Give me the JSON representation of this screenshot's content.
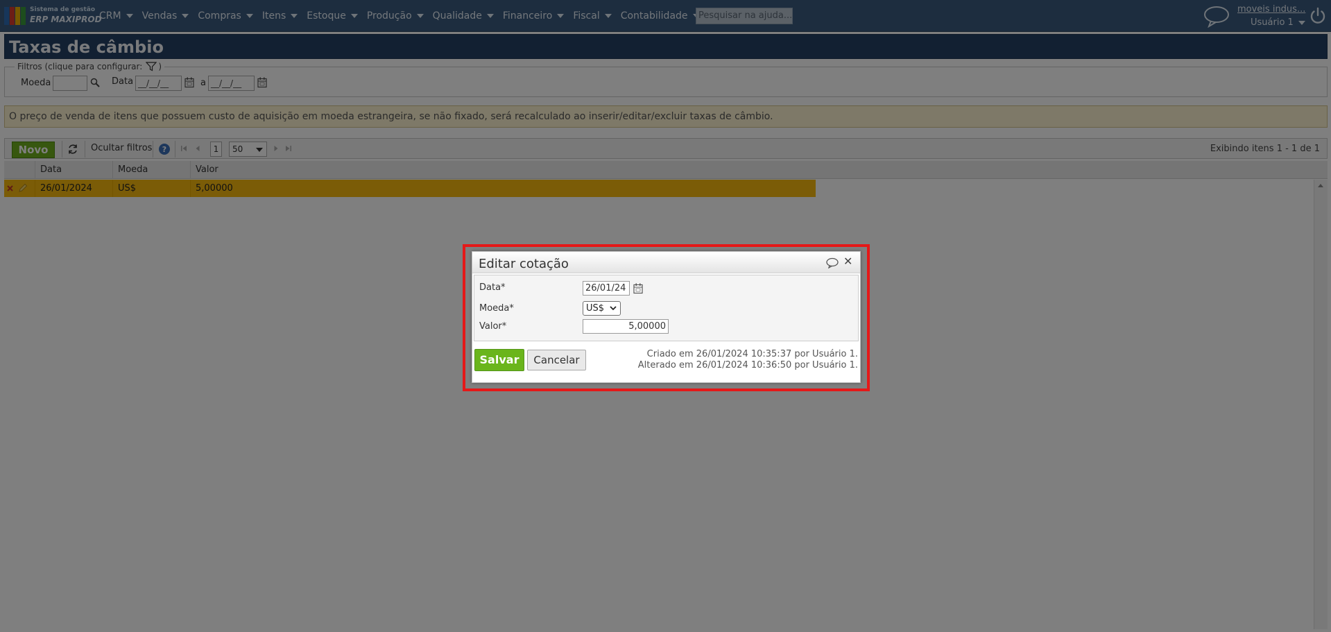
{
  "header": {
    "logo_line1": "Sistema de gestão",
    "logo_line2": "ERP MAXIPROD",
    "menu": [
      "CRM",
      "Vendas",
      "Compras",
      "Itens",
      "Estoque",
      "Produção",
      "Qualidade",
      "Financeiro",
      "Fiscal",
      "Contabilidade"
    ],
    "search_placeholder": "Pesquisar na ajuda...",
    "company": "moveis indus...",
    "user": "Usuário 1"
  },
  "page": {
    "title": "Taxas de câmbio",
    "filters": {
      "legend": "Filtros (clique para configurar:",
      "legend_close": ")",
      "moeda_label": "Moeda",
      "data_label": "Data",
      "date_mask_from": "__/__/__",
      "to_label": "a",
      "date_mask_to": "__/__/__"
    },
    "info_message": "O preço de venda de itens que possuem custo de aquisição em moeda estrangeira, se não fixado, será recalculado ao inserir/editar/excluir taxas de câmbio.",
    "toolbar": {
      "novo": "Novo",
      "hide_filters": "Ocultar filtros",
      "page": "1",
      "page_size": "50",
      "status": "Exibindo itens 1 - 1 de 1"
    },
    "grid": {
      "columns": [
        "Data",
        "Moeda",
        "Valor"
      ],
      "rows": [
        {
          "data": "26/01/2024",
          "moeda": "US$",
          "valor": "5,00000"
        }
      ]
    }
  },
  "dialog": {
    "title": "Editar cotação",
    "fields": {
      "data_label": "Data*",
      "data_value": "26/01/24",
      "moeda_label": "Moeda*",
      "moeda_value": "US$",
      "valor_label": "Valor*",
      "valor_value": "5,00000"
    },
    "save": "Salvar",
    "cancel": "Cancelar",
    "created": "Criado em 26/01/2024 10:35:37 por Usuário 1.",
    "modified": "Alterado em 26/01/2024 10:36:50 por Usuário 1."
  },
  "colors": {
    "topbar": "#3a5a7e",
    "title_bar": "#254064",
    "selected_row": "#f7b90f",
    "save_button": "#6ab51c",
    "highlight": "#e51818"
  }
}
